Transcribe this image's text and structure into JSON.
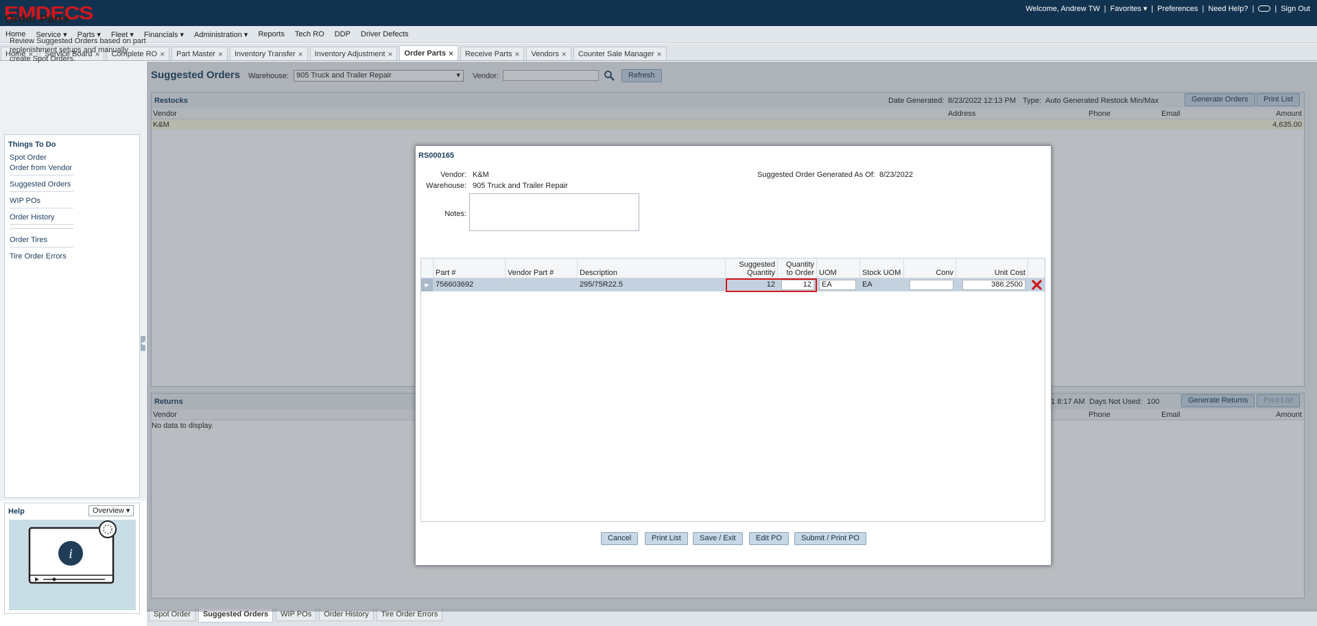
{
  "app": {
    "logo": "EMDECS"
  },
  "topbar": {
    "welcome": "Welcome, Andrew TW",
    "favorites": "Favorites",
    "preferences": "Preferences",
    "help": "Need Help?",
    "signout": "Sign Out"
  },
  "menu": [
    "Home",
    "Service",
    "Parts",
    "Fleet",
    "Financials",
    "Administration",
    "Reports",
    "Tech RO",
    "DDP",
    "Driver Defects"
  ],
  "tabs": [
    "Home",
    "Service Board",
    "Complete RO",
    "Part Master",
    "Inventory Transfer",
    "Inventory Adjustment",
    "Order Parts",
    "Receive Parts",
    "Vendors",
    "Counter Sale Manager"
  ],
  "left": {
    "title": "Order Parts",
    "desc": "Review Suggested Orders based on part replenishment setups and manually create Spot Orders.",
    "things_title": "Things To Do",
    "links": [
      "Spot Order",
      "Order from Vendor",
      "Suggested Orders",
      "WIP POs",
      "Order History",
      "Order Tires",
      "Tire Order Errors"
    ],
    "help_title": "Help",
    "help_select": "Overview"
  },
  "main": {
    "title": "Suggested Orders",
    "warehouse_label": "Warehouse:",
    "warehouse_value": "905 Truck and Trailer Repair",
    "vendor_label": "Vendor:",
    "refresh": "Refresh",
    "restocks": {
      "title": "Restocks",
      "date_label": "Date Generated:",
      "date_value": "8/23/2022 12:13 PM",
      "type_label": "Type:",
      "type_value": "Auto Generated Restock Min/Max",
      "generate_btn": "Generate Orders",
      "print_btn": "Print List",
      "cols": [
        "Vendor",
        "Address",
        "Phone",
        "Email",
        "Amount"
      ],
      "row": {
        "vendor": "K&M",
        "amount": "4,635.00"
      }
    },
    "returns": {
      "title": "Returns",
      "date_partial": "1 8:17 AM",
      "days_label": "Days Not Used:",
      "days_value": "100",
      "generate_btn": "Generate Returns",
      "print_btn": "Print List",
      "cols": [
        "Vendor",
        "Phone",
        "Email",
        "Amount"
      ],
      "empty": "No data to display."
    }
  },
  "modal": {
    "id": "RS000165",
    "vendor_label": "Vendor:",
    "vendor_value": "K&M",
    "warehouse_label": "Warehouse:",
    "warehouse_value": "905 Truck and Trailer Repair",
    "generated_label": "Suggested Order Generated As Of:",
    "generated_value": "8/23/2022",
    "notes_label": "Notes:",
    "cols": {
      "part": "Part #",
      "vendor_part": "Vendor Part #",
      "desc": "Description",
      "suggested_1": "Suggested",
      "suggested_2": "Quantity",
      "qty_1": "Quantity",
      "qty_2": "to Order",
      "uom": "UOM",
      "stock_uom": "Stock UOM",
      "conv": "Conv",
      "unit_cost": "Unit Cost"
    },
    "row": {
      "part": "756603692",
      "vendor_part": "",
      "desc": "295/75R22.5",
      "suggested": "12",
      "qty": "12",
      "uom": "EA",
      "stock_uom": "EA",
      "conv": "",
      "unit_cost": "386.2500"
    },
    "buttons": {
      "cancel": "Cancel",
      "print": "Print List",
      "save": "Save / Exit",
      "edit": "Edit PO",
      "submit": "Submit / Print PO"
    }
  },
  "bottom_tabs": [
    "Spot Order",
    "Suggested Orders",
    "WIP POs",
    "Order History",
    "Tire Order Errors"
  ],
  "colors": {
    "topbar": "#123350",
    "logo": "#d4161c",
    "accent": "#183b5c",
    "highlight_border": "#d2151b"
  }
}
